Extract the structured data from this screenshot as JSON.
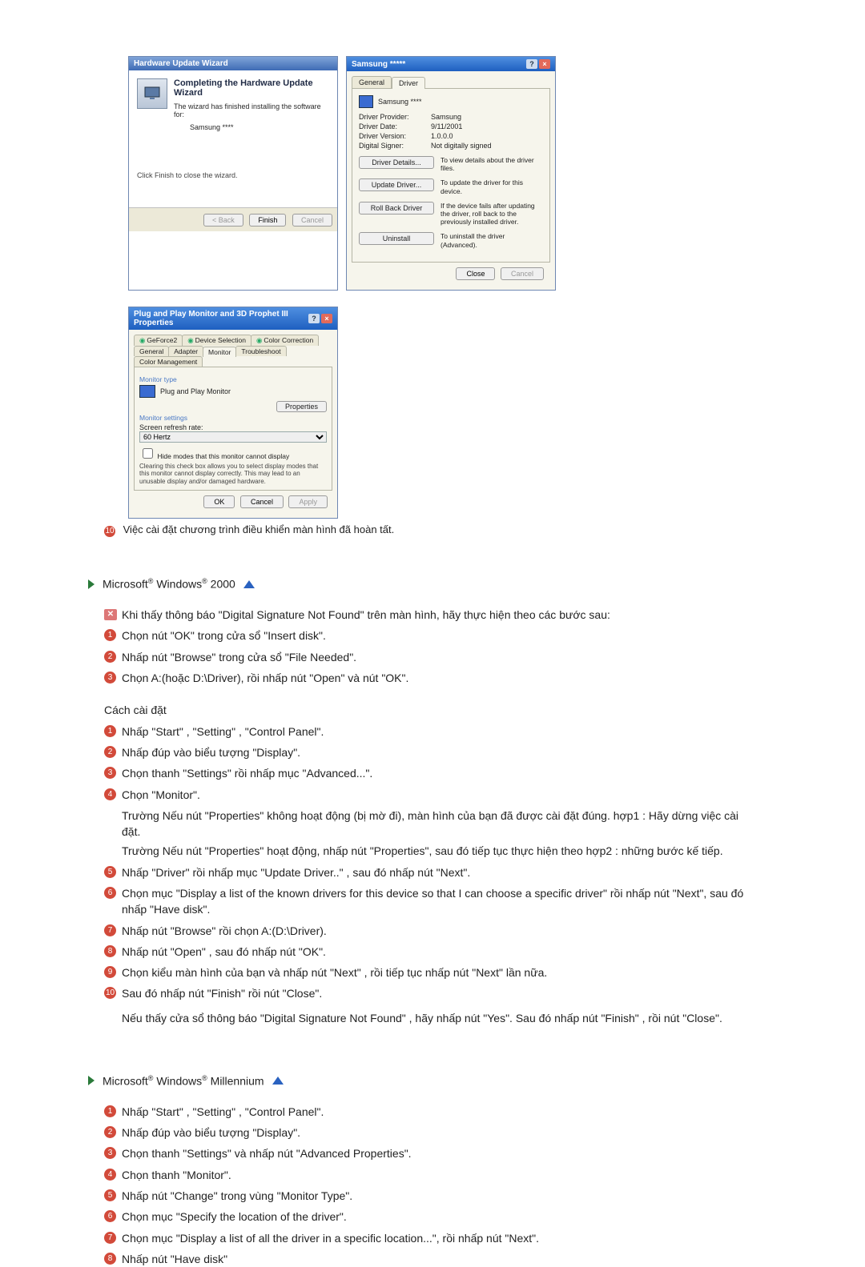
{
  "wizard": {
    "title": "Hardware Update Wizard",
    "heading": "Completing the Hardware Update Wizard",
    "sub": "The wizard has finished installing the software for:",
    "device": "Samsung ****",
    "finish_note": "Click Finish to close the wizard.",
    "btn_back": "< Back",
    "btn_finish": "Finish",
    "btn_cancel": "Cancel"
  },
  "driver": {
    "title": "Samsung *****",
    "tab_general": "General",
    "tab_driver": "Driver",
    "device": "Samsung ****",
    "rows": {
      "provider_k": "Driver Provider:",
      "provider_v": "Samsung",
      "date_k": "Driver Date:",
      "date_v": "9/11/2001",
      "version_k": "Driver Version:",
      "version_v": "1.0.0.0",
      "signer_k": "Digital Signer:",
      "signer_v": "Not digitally signed"
    },
    "actions": {
      "details_btn": "Driver Details...",
      "details_desc": "To view details about the driver files.",
      "update_btn": "Update Driver...",
      "update_desc": "To update the driver for this device.",
      "rollback_btn": "Roll Back Driver",
      "rollback_desc": "If the device fails after updating the driver, roll back to the previously installed driver.",
      "uninstall_btn": "Uninstall",
      "uninstall_desc": "To uninstall the driver (Advanced)."
    },
    "btn_close": "Close",
    "btn_cancel": "Cancel"
  },
  "pnp": {
    "title": "Plug and Play Monitor and 3D Prophet III Properties",
    "tabs_top": [
      "GeForce2",
      "Device Selection",
      "Color Correction"
    ],
    "tabs_bot": [
      "General",
      "Adapter",
      "Monitor",
      "Troubleshoot",
      "Color Management"
    ],
    "grp_monitor_type": "Monitor type",
    "monitor_name": "Plug and Play Monitor",
    "btn_properties": "Properties",
    "grp_settings": "Monitor settings",
    "label_refresh": "Screen refresh rate:",
    "refresh_value": "60 Hertz",
    "chk_hide": "Hide modes that this monitor cannot display",
    "note": "Clearing this check box allows you to select display modes that this monitor cannot display correctly. This may lead to an unusable display and/or damaged hardware.",
    "btn_ok": "OK",
    "btn_cancel": "Cancel",
    "btn_apply": "Apply"
  },
  "caption_final": "Việc cài đặt chương trình điều khiển màn hình đã hoàn tất.",
  "caption_final_num": "10",
  "win2000": {
    "heading_html": "Microsoft® Windows® 2000",
    "lead": "Khi thấy thông báo \"Digital Signature Not Found\" trên màn hình, hãy thực hiện theo các bước sau:",
    "steps_a": [
      "Chọn nút \"OK\" trong cửa sổ \"Insert disk\".",
      "Nhấp nút \"Browse\" trong cửa sổ \"File Needed\".",
      "Chọn A:(hoặc D:\\Driver), rồi nhấp nút \"Open\" và nút \"OK\"."
    ],
    "how_label": "Cách cài đặt",
    "steps_b": [
      "Nhấp \"Start\" , \"Setting\" , \"Control Panel\".",
      "Nhấp đúp vào biểu tượng \"Display\".",
      "Chọn thanh \"Settings\" rồi nhấp mục \"Advanced...\".",
      "Chọn \"Monitor\"."
    ],
    "case1": "Trường Nếu nút \"Properties\" không hoạt động (bị mờ đi), màn hình của bạn đã được cài đặt đúng. hợp1 :   Hãy dừng việc cài đặt.",
    "case2": "Trường Nếu nút \"Properties\" hoạt động, nhấp nút \"Properties\", sau đó tiếp tục thực hiện theo hợp2 :   những bước kế tiếp.",
    "steps_c": [
      "Nhấp \"Driver\" rồi nhấp mục \"Update Driver..\" , sau đó nhấp nút \"Next\".",
      "Chọn mục \"Display a list of the known drivers for this device so that I can choose a specific driver\" rồi nhấp nút \"Next\", sau đó nhấp \"Have disk\".",
      "Nhấp nút \"Browse\" rồi chọn A:(D:\\Driver).",
      "Nhấp nút \"Open\" , sau đó nhấp nút \"OK\".",
      "Chọn kiểu màn hình của bạn và nhấp nút \"Next\" , rồi tiếp tục nhấp nút \"Next\" lần nữa.",
      "Sau đó nhấp nút \"Finish\" rồi nút \"Close\"."
    ],
    "tail": "Nếu thấy cửa sổ thông báo \"Digital Signature Not Found\" , hãy nhấp nút \"Yes\". Sau đó nhấp nút \"Finish\" , rồi nút \"Close\"."
  },
  "winme": {
    "heading_html": "Microsoft® Windows® Millennium",
    "steps": [
      "Nhấp \"Start\" , \"Setting\" , \"Control Panel\".",
      "Nhấp đúp vào biểu tượng \"Display\".",
      "Chọn thanh \"Settings\" và nhấp nút \"Advanced Properties\".",
      "Chọn thanh \"Monitor\".",
      "Nhấp nút \"Change\" trong vùng \"Monitor Type\".",
      "Chọn mục \"Specify the location of the driver\".",
      "Chọn mục \"Display a list of all the driver in a specific location...\", rồi nhấp nút \"Next\".",
      "Nhấp nút \"Have disk\""
    ]
  }
}
